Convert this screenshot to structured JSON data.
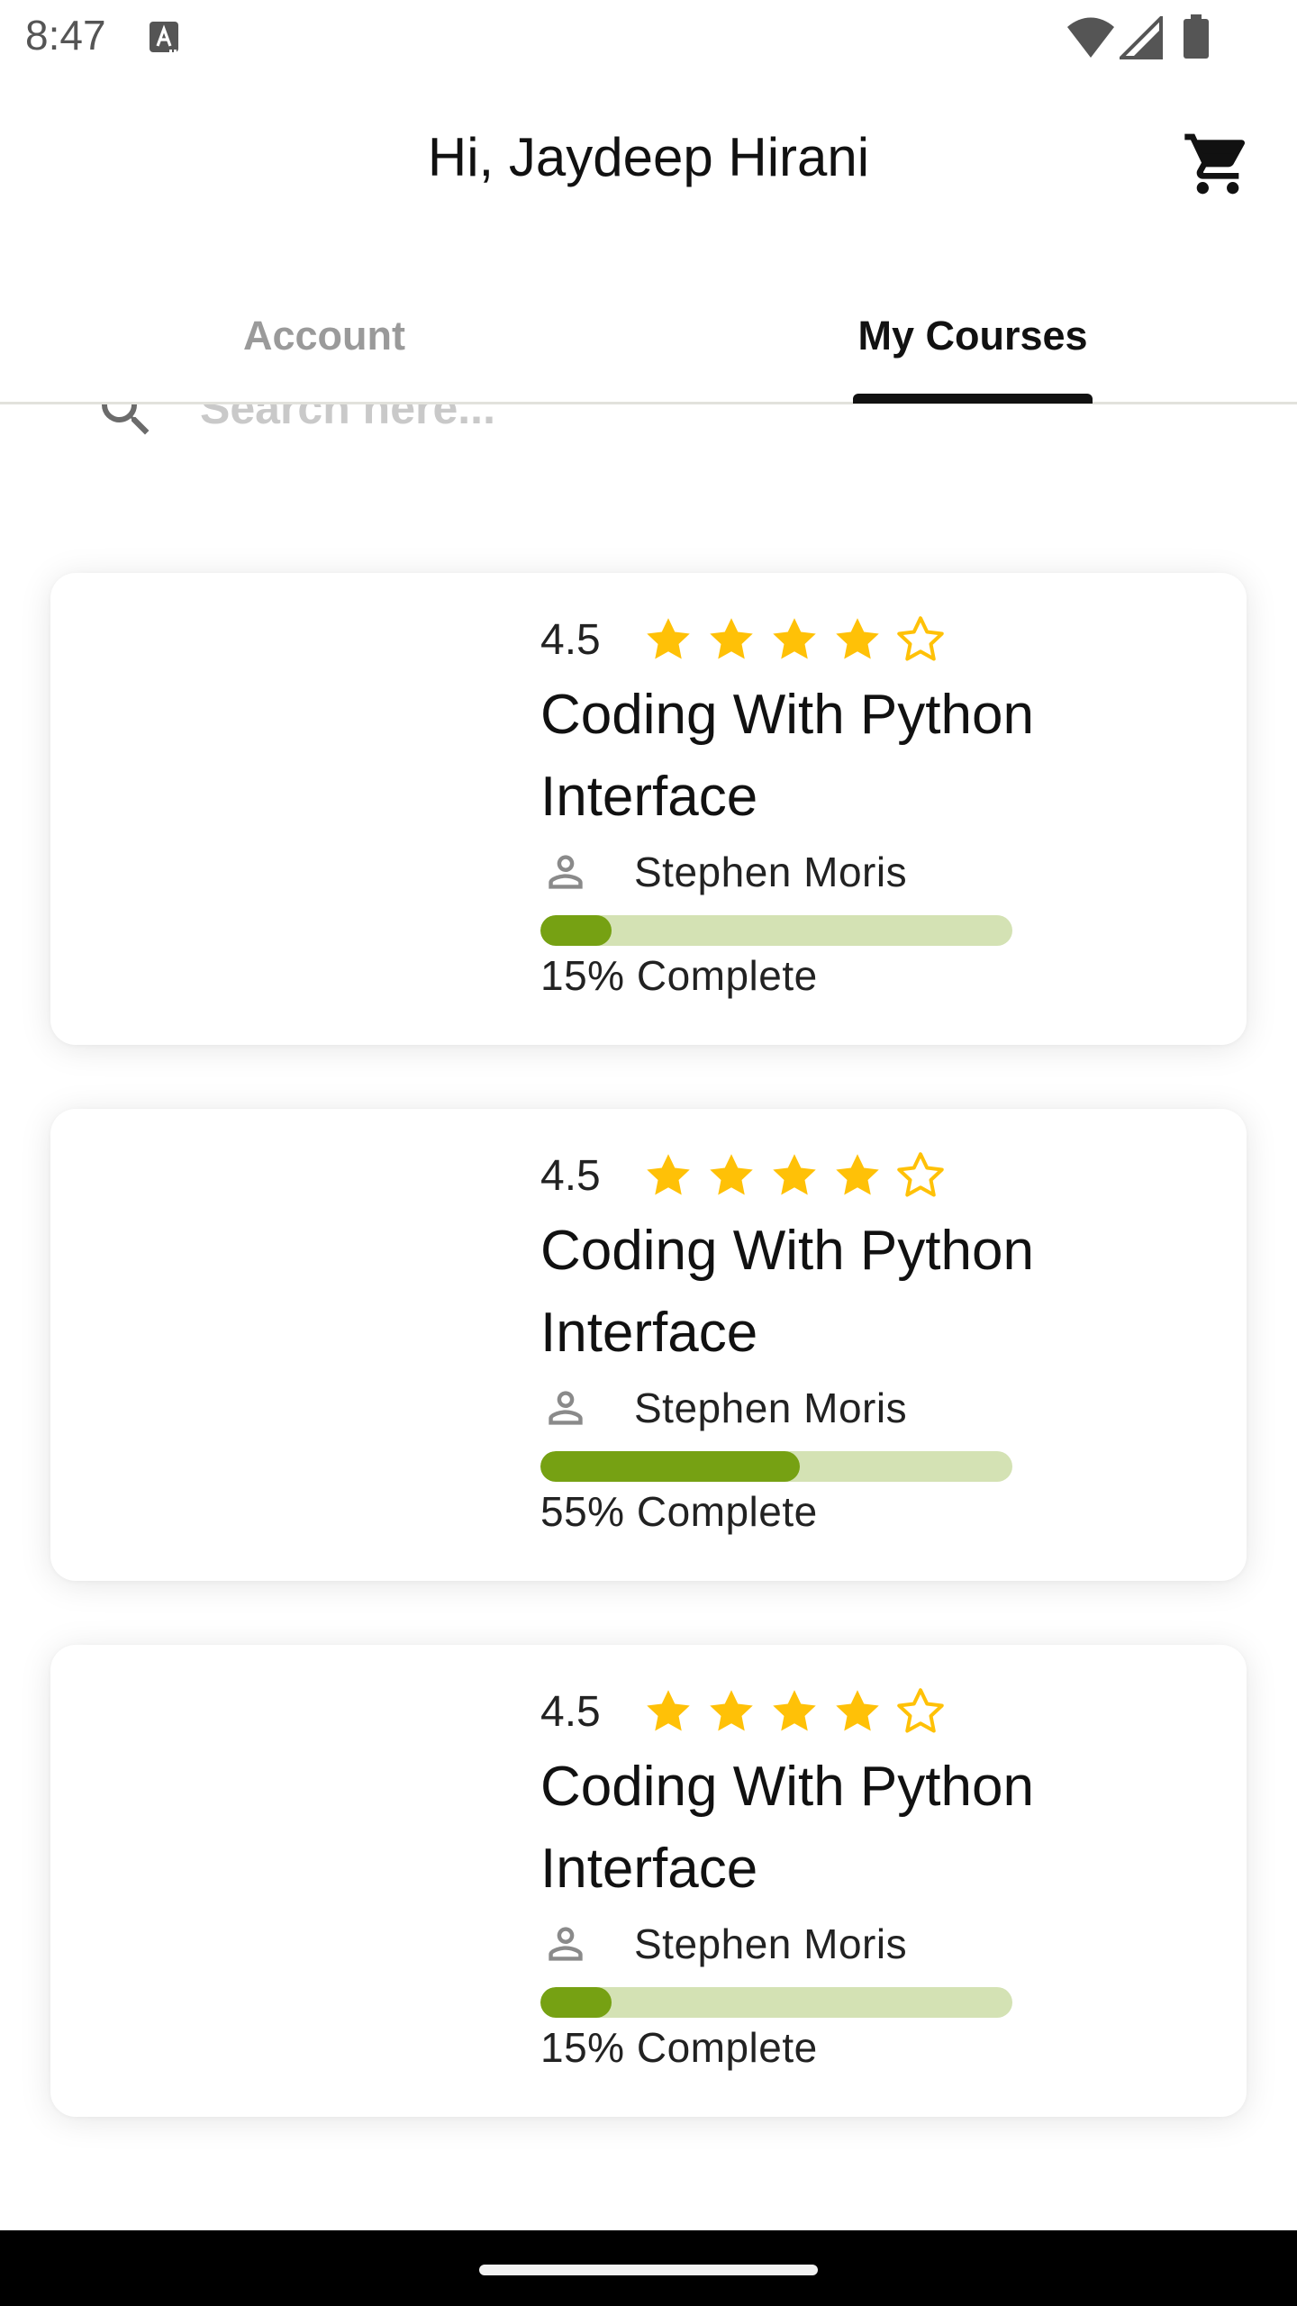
{
  "status_bar": {
    "time": "8:47",
    "icons": [
      "keyboard-a-icon",
      "wifi-icon",
      "signal-icon",
      "battery-icon"
    ]
  },
  "header": {
    "greeting": "Hi, Jaydeep Hirani",
    "cart_icon": "cart-icon"
  },
  "tabs": [
    {
      "label": "Account",
      "selected": false
    },
    {
      "label": "My Courses",
      "selected": true
    }
  ],
  "search": {
    "placeholder": "Search here...",
    "icon": "search-icon"
  },
  "courses": [
    {
      "rating": "4.5",
      "stars_filled": 4,
      "stars_total": 5,
      "title": "Coding With Python Interface",
      "instructor": "Stephen Moris",
      "progress": 0.15,
      "progress_label": "15% Complete"
    },
    {
      "rating": "4.5",
      "stars_filled": 4,
      "stars_total": 5,
      "title": "Coding With Python Interface",
      "instructor": "Stephen Moris",
      "progress": 0.55,
      "progress_label": "55% Complete"
    },
    {
      "rating": "4.5",
      "stars_filled": 4,
      "stars_total": 5,
      "title": "Coding With Python Interface",
      "instructor": "Stephen Moris",
      "progress": 0.15,
      "progress_label": "15% Complete"
    }
  ],
  "colors": {
    "star": "#FFC107",
    "progress_fill": "#76A113",
    "progress_track": "#D4E2B4",
    "tab_active": "#111111",
    "tab_inactive": "#9A9A9A"
  }
}
